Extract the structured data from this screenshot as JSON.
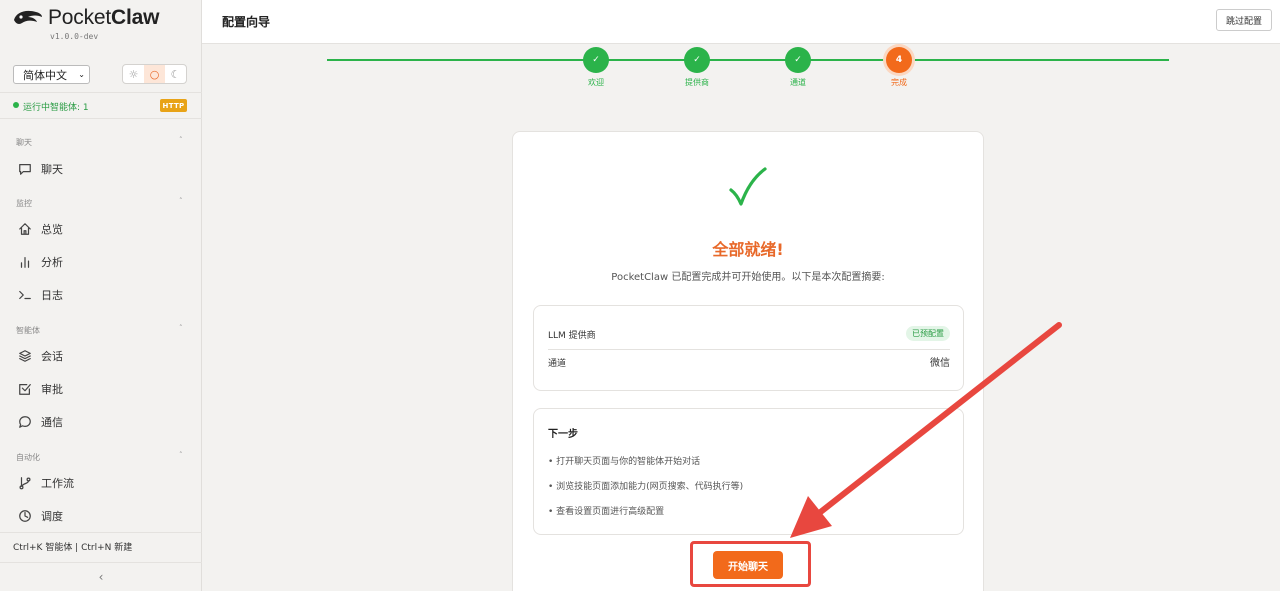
{
  "brand": {
    "name_light": "Pocket",
    "name_bold": "Claw",
    "version": "v1.0.0-dev"
  },
  "language": {
    "selected": "简体中文"
  },
  "theme": {
    "options": [
      "☼",
      "○",
      "☾"
    ],
    "selected_index": 1
  },
  "status": {
    "text": "运行中智能体: 1",
    "badge": "HTTP"
  },
  "sidebar": {
    "sections": [
      {
        "label": "聊天",
        "items": [
          {
            "label": "聊天",
            "icon": "chat-icon"
          }
        ]
      },
      {
        "label": "监控",
        "items": [
          {
            "label": "总览",
            "icon": "home-icon"
          },
          {
            "label": "分析",
            "icon": "bar-chart-icon"
          },
          {
            "label": "日志",
            "icon": "terminal-icon"
          }
        ]
      },
      {
        "label": "智能体",
        "items": [
          {
            "label": "会话",
            "icon": "layers-icon"
          },
          {
            "label": "审批",
            "icon": "checkbox-icon"
          },
          {
            "label": "通信",
            "icon": "message-icon"
          }
        ]
      },
      {
        "label": "自动化",
        "items": [
          {
            "label": "工作流",
            "icon": "branch-icon"
          },
          {
            "label": "调度",
            "icon": "clock-icon"
          }
        ]
      }
    ],
    "shortcut": "Ctrl+K 智能体 | Ctrl+N 新建",
    "collapse": "‹"
  },
  "header": {
    "title": "配置向导",
    "skip_label": "跳过配置"
  },
  "steps": [
    {
      "label": "欢迎",
      "mark": "✓",
      "state": "done"
    },
    {
      "label": "提供商",
      "mark": "✓",
      "state": "done"
    },
    {
      "label": "通道",
      "mark": "✓",
      "state": "done"
    },
    {
      "label": "完成",
      "mark": "4",
      "state": "current"
    }
  ],
  "complete": {
    "title": "全部就绪!",
    "description": "PocketClaw 已配置完成并可开始使用。以下是本次配置摘要:",
    "summary": [
      {
        "key": "LLM 提供商",
        "value": "已预配置",
        "style": "badge"
      },
      {
        "key": "通道",
        "value": "微信",
        "style": "text"
      }
    ],
    "next_title": "下一步",
    "next_items": [
      "• 打开聊天页面与你的智能体开始对话",
      "• 浏览技能页面添加能力(网页搜索、代码执行等)",
      "• 查看设置页面进行高级配置"
    ],
    "start_label": "开始聊天"
  },
  "colors": {
    "accent": "#f26a1b",
    "success": "#2bb34a",
    "annotation": "#e8473f"
  }
}
